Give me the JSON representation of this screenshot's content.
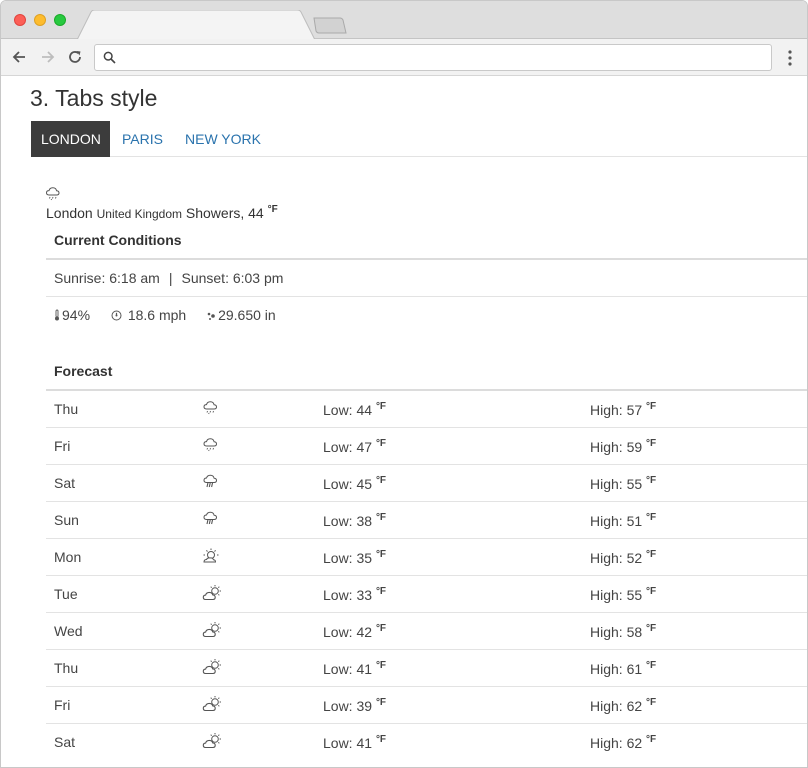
{
  "browser": {
    "url": "",
    "icons": {
      "back": "back-arrow-icon",
      "forward": "forward-arrow-icon",
      "reload": "reload-icon",
      "search": "search-icon",
      "menu": "kebab-menu-icon"
    }
  },
  "page": {
    "section_title": "3. Tabs style",
    "tabs": [
      {
        "label": "LONDON",
        "active": true
      },
      {
        "label": "PARIS",
        "active": false
      },
      {
        "label": "NEW YORK",
        "active": false
      }
    ],
    "accent_color": "#2a73ad",
    "active_tab_color": "#3c3c3c"
  },
  "current": {
    "icon": "showers-icon",
    "city": "London",
    "country": "United Kingdom",
    "summary": "Showers, 44",
    "unit": "°F",
    "conditions_heading": "Current Conditions",
    "sunrise": "Sunrise: 6:18 am",
    "separator": "|",
    "sunset": "Sunset: 6:03 pm",
    "humidity": "94%",
    "wind": "18.6 mph",
    "pressure": "29.650 in"
  },
  "forecast": {
    "heading": "Forecast",
    "days": [
      {
        "day": "Thu",
        "icon": "showers-icon",
        "low": "Low: 44",
        "high": "High: 57"
      },
      {
        "day": "Fri",
        "icon": "showers-icon",
        "low": "Low: 47",
        "high": "High: 59"
      },
      {
        "day": "Sat",
        "icon": "rain-icon",
        "low": "Low: 45",
        "high": "High: 55"
      },
      {
        "day": "Sun",
        "icon": "rain-icon",
        "low": "Low: 38",
        "high": "High: 51"
      },
      {
        "day": "Mon",
        "icon": "mostly-sunny-icon",
        "low": "Low: 35",
        "high": "High: 52"
      },
      {
        "day": "Tue",
        "icon": "partly-cloudy-icon",
        "low": "Low: 33",
        "high": "High: 55"
      },
      {
        "day": "Wed",
        "icon": "partly-cloudy-icon",
        "low": "Low: 42",
        "high": "High: 58"
      },
      {
        "day": "Thu",
        "icon": "partly-cloudy-icon",
        "low": "Low: 41",
        "high": "High: 61"
      },
      {
        "day": "Fri",
        "icon": "partly-cloudy-icon",
        "low": "Low: 39",
        "high": "High: 62"
      },
      {
        "day": "Sat",
        "icon": "partly-cloudy-icon",
        "low": "Low: 41",
        "high": "High: 62"
      }
    ]
  }
}
